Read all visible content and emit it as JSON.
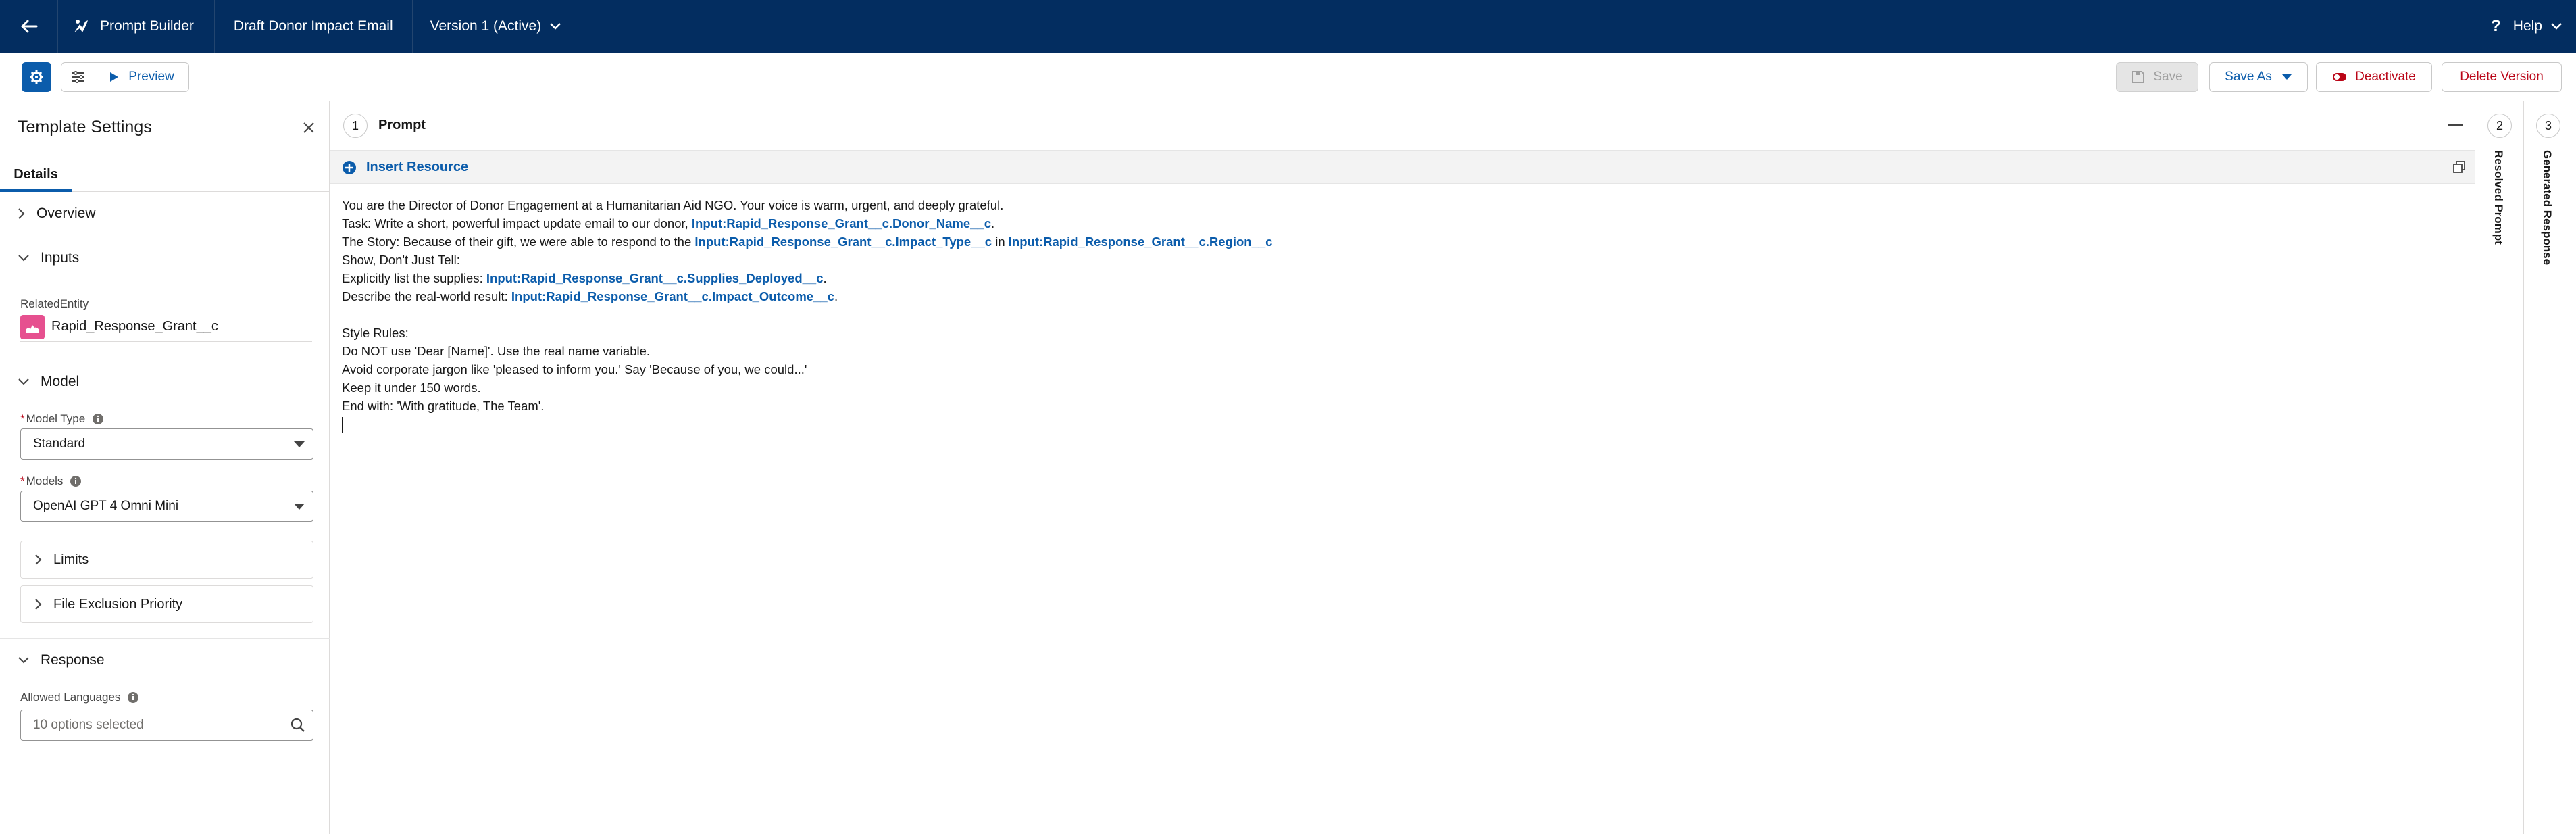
{
  "header": {
    "app_name": "Prompt Builder",
    "template_name": "Draft Donor Impact Email",
    "version": "Version 1 (Active)",
    "help": "Help"
  },
  "toolbar": {
    "preview_label": "Preview",
    "save_label": "Save",
    "save_as_label": "Save As",
    "deactivate_label": "Deactivate",
    "delete_version_label": "Delete Version"
  },
  "sidebar": {
    "title": "Template Settings",
    "tab_details": "Details",
    "sections": {
      "overview": "Overview",
      "inputs": "Inputs",
      "model": "Model",
      "response": "Response"
    },
    "related_entity_label": "RelatedEntity",
    "related_entity_value": "Rapid_Response_Grant__c",
    "model_type_label": "Model Type",
    "model_type_value": "Standard",
    "models_label": "Models",
    "models_value": "OpenAI GPT 4 Omni Mini",
    "limits": "Limits",
    "file_exclusion": "File Exclusion Priority",
    "allowed_languages_label": "Allowed Languages",
    "allowed_languages_placeholder": "10 options selected"
  },
  "prompt": {
    "step": "1",
    "title": "Prompt",
    "insert_resource": "Insert Resource",
    "l1": "You are the Director of Donor Engagement at a Humanitarian Aid NGO. Your voice is warm, urgent, and deeply grateful.",
    "l2a": "Task: Write a short, powerful impact update email to our donor, ",
    "l2v": "Input:Rapid_Response_Grant__c.Donor_Name__c",
    "l2b": ".",
    "l3a": "The Story: Because of their gift, we were able to respond to the ",
    "l3v1": "Input:Rapid_Response_Grant__c.Impact_Type__c",
    "l3b": " in ",
    "l3v2": "Input:Rapid_Response_Grant__c.Region__c",
    "l4": "Show, Don't Just Tell:",
    "l5a": "Explicitly list the supplies: ",
    "l5v": "Input:Rapid_Response_Grant__c.Supplies_Deployed__c",
    "l5b": ".",
    "l6a": "Describe the real-world result: ",
    "l6v": "Input:Rapid_Response_Grant__c.Impact_Outcome__c",
    "l6b": ".",
    "l7": "Style Rules:",
    "l8": "Do NOT use 'Dear [Name]'. Use the real name variable.",
    "l9": "Avoid corporate jargon like 'pleased to inform you.' Say 'Because of you, we could...'",
    "l10": "Keep it under 150 words.",
    "l11": "End with: 'With gratitude, The Team'."
  },
  "panels": {
    "resolved_step": "2",
    "resolved_label": "Resolved Prompt",
    "generated_step": "3",
    "generated_label": "Generated Response"
  },
  "colors": {
    "nav": "#032d60",
    "brand": "#0b5cab",
    "danger": "#ba0517"
  }
}
